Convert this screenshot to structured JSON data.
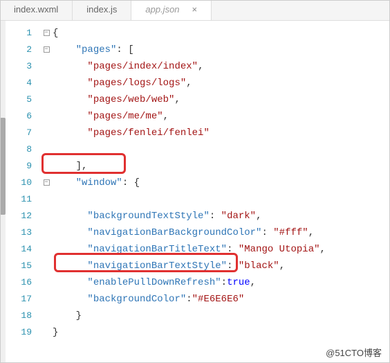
{
  "tabs": [
    {
      "label": "index.wxml",
      "active": false
    },
    {
      "label": "index.js",
      "active": false
    },
    {
      "label": "app.json",
      "active": true
    }
  ],
  "close_glyph": "×",
  "fold_glyph": "−",
  "line_numbers": [
    "1",
    "2",
    "3",
    "4",
    "5",
    "6",
    "7",
    "8",
    "9",
    "10",
    "11",
    "12",
    "13",
    "14",
    "15",
    "16",
    "17",
    "18",
    "19"
  ],
  "code": {
    "l1": {
      "brace": "{"
    },
    "l2": {
      "key": "\"pages\"",
      "after": ": ["
    },
    "l3": {
      "val": "\"pages/index/index\"",
      "comma": ","
    },
    "l4": {
      "val": "\"pages/logs/logs\"",
      "comma": ","
    },
    "l5": {
      "val": "\"pages/web/web\"",
      "comma": ","
    },
    "l6": {
      "val": "\"pages/me/me\"",
      "comma": ","
    },
    "l7": {
      "val": "\"pages/fenlei/fenlei\""
    },
    "l9": {
      "close": "],"
    },
    "l10": {
      "key": "\"window\"",
      "after": ": {"
    },
    "l12": {
      "key": "\"backgroundTextStyle\"",
      "val": "\"dark\"",
      "sep": ": ",
      "comma": ","
    },
    "l13": {
      "key": "\"navigationBarBackgroundColor\"",
      "val": "\"#fff\"",
      "sep": ": ",
      "comma": ","
    },
    "l14": {
      "key": "\"navigationBarTitleText\"",
      "val": "\"Mango Utopia\"",
      "sep": ": ",
      "comma": ","
    },
    "l15": {
      "key": "\"navigationBarTextStyle\"",
      "val": "\"black\"",
      "sep": ": ",
      "comma": ","
    },
    "l16": {
      "key": "\"enablePullDownRefresh\"",
      "val": "true",
      "sep": ":",
      "comma": ","
    },
    "l17": {
      "key": "\"backgroundColor\"",
      "val": "\"#E6E6E6\"",
      "sep": ":"
    },
    "l18": {
      "close": "}"
    },
    "l19": {
      "close": "}"
    }
  },
  "watermark": "@51CTO博客"
}
